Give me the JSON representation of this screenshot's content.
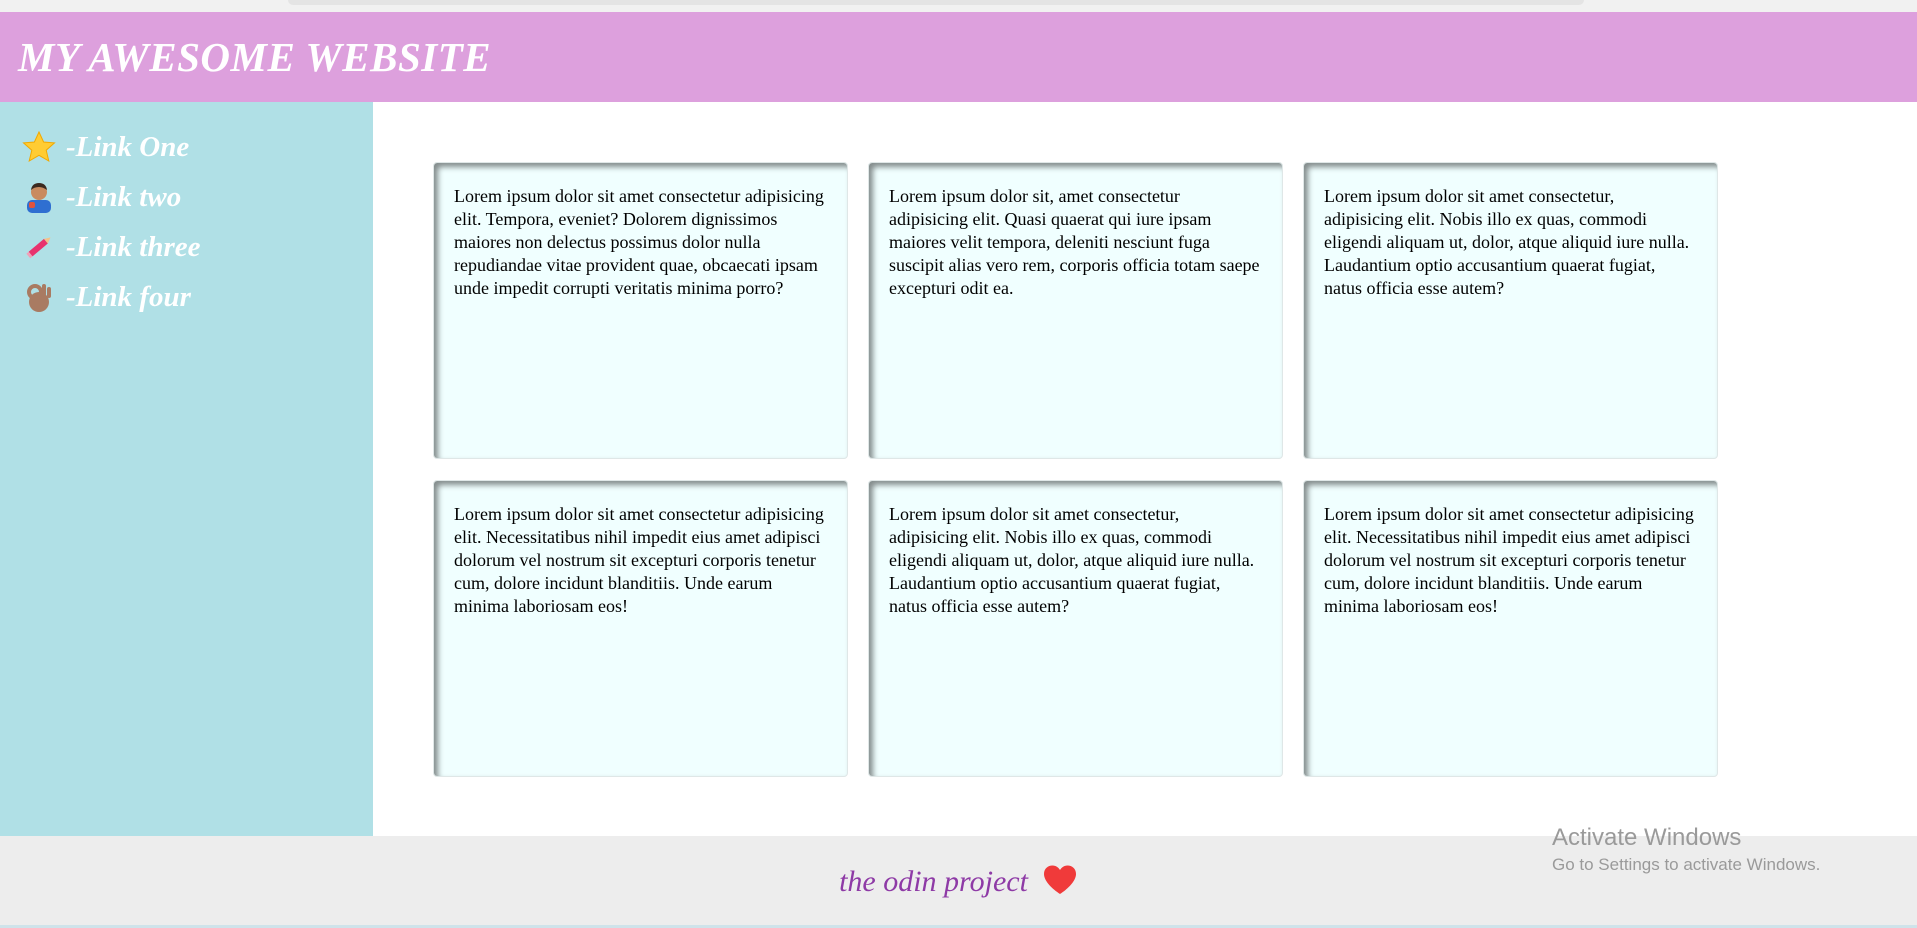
{
  "header": {
    "title": "MY AWESOME WEBSITE"
  },
  "sidebar": {
    "items": [
      {
        "label": "-Link One",
        "icon": "star-icon"
      },
      {
        "label": "-Link two",
        "icon": "person-icon"
      },
      {
        "label": "-Link three",
        "icon": "pencil-icon"
      },
      {
        "label": "-Link four",
        "icon": "ok-hand-icon"
      }
    ]
  },
  "cards": [
    "Lorem ipsum dolor sit amet consectetur adipisicing elit. Tempora, eveniet? Dolorem dignissimos maiores non delectus possimus dolor nulla repudiandae vitae provident quae, obcaecati ipsam unde impedit corrupti veritatis minima porro?",
    "Lorem ipsum dolor sit, amet consectetur adipisicing elit. Quasi quaerat qui iure ipsam maiores velit tempora, deleniti nesciunt fuga suscipit alias vero rem, corporis officia totam saepe excepturi odit ea.",
    "Lorem ipsum dolor sit amet consectetur, adipisicing elit. Nobis illo ex quas, commodi eligendi aliquam ut, dolor, atque aliquid iure nulla. Laudantium optio accusantium quaerat fugiat, natus officia esse autem?",
    "Lorem ipsum dolor sit amet consectetur adipisicing elit. Necessitatibus nihil impedit eius amet adipisci dolorum vel nostrum sit excepturi corporis tenetur cum, dolore incidunt blanditiis. Unde earum minima laboriosam eos!",
    "Lorem ipsum dolor sit amet consectetur, adipisicing elit. Nobis illo ex quas, commodi eligendi aliquam ut, dolor, atque aliquid iure nulla. Laudantium optio accusantium quaerat fugiat, natus officia esse autem?",
    "Lorem ipsum dolor sit amet consectetur adipisicing elit. Necessitatibus nihil impedit eius amet adipisci dolorum vel nostrum sit excepturi corporis tenetur cum, dolore incidunt blanditiis. Unde earum minima laboriosam eos!"
  ],
  "footer": {
    "text": "the odin project",
    "icon": "heart-icon"
  },
  "watermark": {
    "title": "Activate Windows",
    "subtitle": "Go to Settings to activate Windows."
  },
  "colors": {
    "header_bg": "#dda0dd",
    "sidebar_bg": "#b0e0e6",
    "card_bg": "#f0ffff",
    "footer_bg": "#ededed",
    "footer_text": "#8e3aa6",
    "heart": "#f03a3a"
  }
}
